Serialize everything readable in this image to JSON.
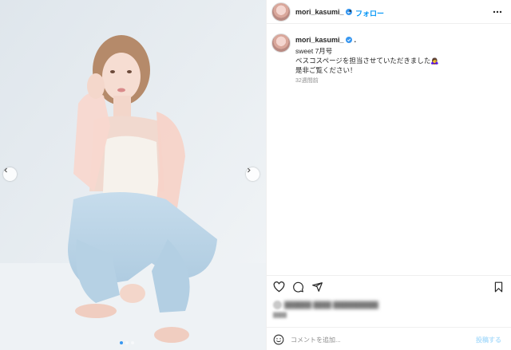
{
  "post": {
    "username": "mori_kasumi_",
    "follow_label": "フォロー",
    "separator": "•",
    "caption_line_1": "sweet 7月号",
    "caption_line_2": "ベスコスページを担当させていただきました",
    "caption_emoji": "🙇‍♀️",
    "caption_line_3": "是非ご覧ください！",
    "caption_dot": ".",
    "timestamp": "32週間前"
  },
  "carousel": {
    "slide_count": 3,
    "active_index": 0
  },
  "actions": {
    "icons": [
      "heart-icon",
      "comment-icon",
      "share-icon",
      "bookmark-icon"
    ]
  },
  "comment": {
    "placeholder": "コメントを追加...",
    "post_label": "投稿する"
  },
  "colors": {
    "accent": "#0095f6",
    "verified": "#3897f0",
    "muted": "#8e8e8e",
    "border": "#efefef"
  }
}
